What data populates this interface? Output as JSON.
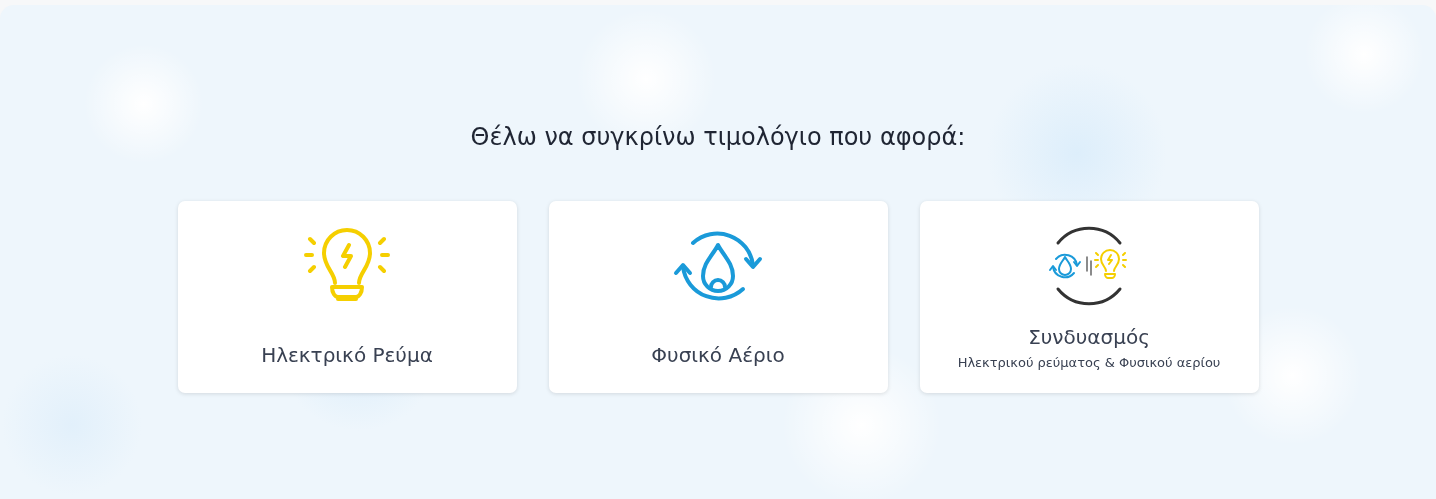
{
  "heading": "Θέλω να συγκρίνω τιμολόγιο που αφορά:",
  "options": [
    {
      "kind": "electricity",
      "label": "Ηλεκτρικό Ρεύμα"
    },
    {
      "kind": "gas",
      "label": "Φυσικό Αέριο"
    },
    {
      "kind": "combo",
      "label": "Συνδυασμός",
      "subtitle": "Ηλεκτρικού ρεύματος & Φυσικού αερίου"
    }
  ]
}
